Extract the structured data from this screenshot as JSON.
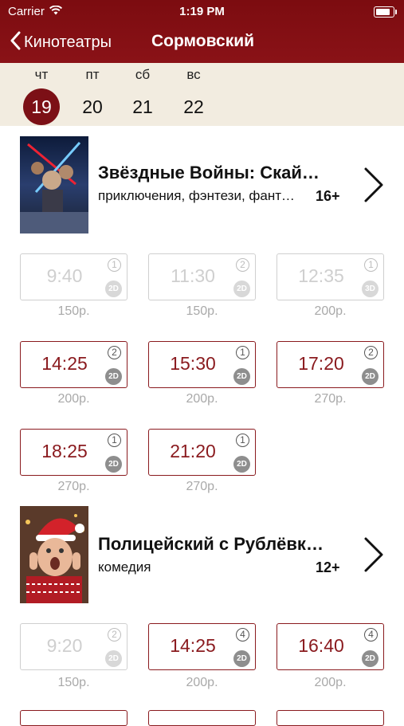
{
  "status": {
    "carrier": "Carrier",
    "time": "1:19 PM"
  },
  "nav": {
    "back_label": "Кинотеатры",
    "title": "Сормовский"
  },
  "days": [
    {
      "dow": "чт",
      "num": "19",
      "active": true
    },
    {
      "dow": "пт",
      "num": "20",
      "active": false
    },
    {
      "dow": "сб",
      "num": "21",
      "active": false
    },
    {
      "dow": "вс",
      "num": "22",
      "active": false
    }
  ],
  "movies": [
    {
      "title": "Звёздные Войны: Скайуокер. Восход",
      "genre": "приключения, фэнтези, фантастика",
      "age": "16+",
      "sessions": [
        {
          "time": "9:40",
          "hall": "1",
          "format": "2D",
          "price": "150р.",
          "past": true
        },
        {
          "time": "11:30",
          "hall": "2",
          "format": "2D",
          "price": "150р.",
          "past": true
        },
        {
          "time": "12:35",
          "hall": "1",
          "format": "3D",
          "price": "200р.",
          "past": true
        },
        {
          "time": "14:25",
          "hall": "2",
          "format": "2D",
          "price": "200р.",
          "past": false
        },
        {
          "time": "15:30",
          "hall": "1",
          "format": "2D",
          "price": "200р.",
          "past": false
        },
        {
          "time": "17:20",
          "hall": "2",
          "format": "2D",
          "price": "270р.",
          "past": false
        },
        {
          "time": "18:25",
          "hall": "1",
          "format": "2D",
          "price": "270р.",
          "past": false
        },
        {
          "time": "21:20",
          "hall": "1",
          "format": "2D",
          "price": "270р.",
          "past": false
        }
      ]
    },
    {
      "title": "Полицейский с Рублёвки. Новогодний беспредел",
      "genre": "комедия",
      "age": "12+",
      "sessions": [
        {
          "time": "9:20",
          "hall": "2",
          "format": "2D",
          "price": "150р.",
          "past": true
        },
        {
          "time": "14:25",
          "hall": "4",
          "format": "2D",
          "price": "200р.",
          "past": false
        },
        {
          "time": "16:40",
          "hall": "4",
          "format": "2D",
          "price": "200р.",
          "past": false
        }
      ]
    }
  ]
}
